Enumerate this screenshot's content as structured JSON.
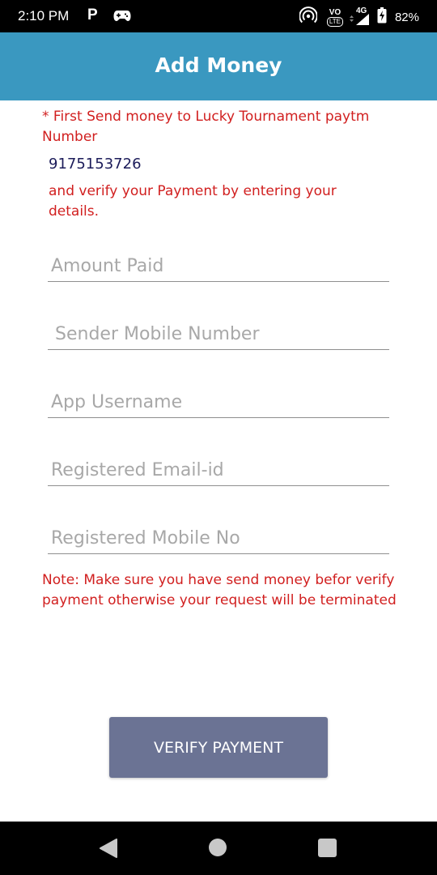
{
  "status_bar": {
    "time": "2:10 PM",
    "p_icon_label": "P",
    "volte_label": "VO",
    "lte_label": "LTE",
    "network_label": "4G",
    "battery_pct": "82%"
  },
  "header": {
    "title": "Add Money",
    "bg_color": "#3a98c0"
  },
  "instructions": {
    "line1": "* First Send money to Lucky Tournament paytm Number",
    "paytm_number": "9175153726",
    "line2": "and verify your Payment by entering your details."
  },
  "form": {
    "amount_placeholder": "Amount Paid",
    "sender_placeholder": "Sender Mobile Number",
    "username_placeholder": "App Username",
    "email_placeholder": "Registered Email-id",
    "mobile_placeholder": "Registered Mobile No"
  },
  "note": "Note: Make sure you have send money befor verify payment otherwise your request will be terminated",
  "verify_button": {
    "label": "VERIFY PAYMENT",
    "bg_color": "#6b7394"
  },
  "colors": {
    "warning_red": "#d11f1f",
    "number_navy": "#1c1c5a"
  },
  "icons": [
    "parking-icon",
    "gamepad-icon",
    "hotspot-icon",
    "volte-icon",
    "signal-icon",
    "battery-charging-icon",
    "nav-back-icon",
    "nav-home-icon",
    "nav-recents-icon"
  ]
}
